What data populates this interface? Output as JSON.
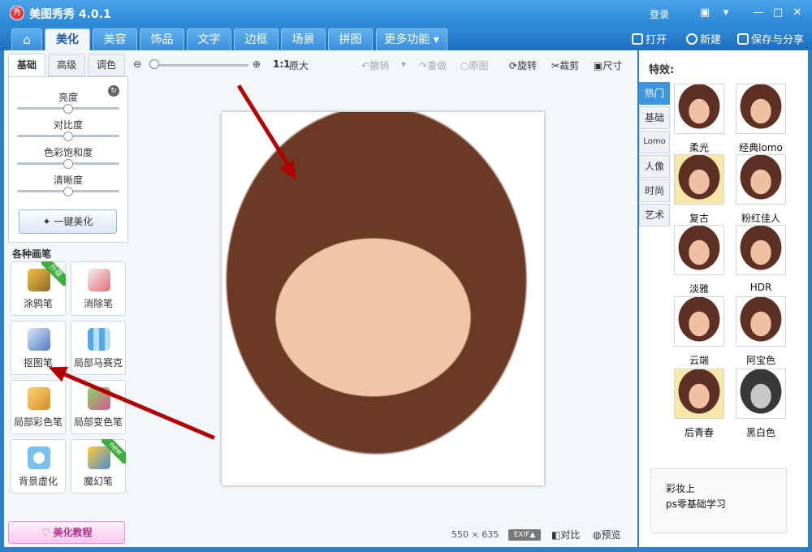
{
  "window": {
    "title": "美图秀秀 4.0.1",
    "logo_text": "秀",
    "login": "登录",
    "controls": [
      "▣",
      "▾",
      "—",
      "□",
      "✕"
    ]
  },
  "nav": {
    "home_icon": "home-icon",
    "tabs": [
      "美化",
      "美容",
      "饰品",
      "文字",
      "边框",
      "场景",
      "拼图",
      "更多功能 ▾"
    ],
    "actions": {
      "open": "打开",
      "new": "新建",
      "save_share": "保存与分享"
    }
  },
  "left": {
    "tabs": [
      "基础",
      "高级",
      "调色"
    ],
    "sliders": [
      {
        "label": "亮度",
        "value": 0.5
      },
      {
        "label": "对比度",
        "value": 0.5
      },
      {
        "label": "色彩饱和度",
        "value": 0.5
      },
      {
        "label": "清晰度",
        "value": 0.5
      }
    ],
    "one_click": "一键美化",
    "brushes_title": "各种画笔",
    "brushes": [
      {
        "label": "涂鸦笔",
        "badge": "升级",
        "icon": "pencil-icon"
      },
      {
        "label": "消除笔",
        "badge": "",
        "icon": "eraser-icon"
      },
      {
        "label": "抠图笔",
        "badge": "",
        "icon": "cutout-pen-icon"
      },
      {
        "label": "局部马赛克",
        "badge": "",
        "icon": "mosaic-icon"
      },
      {
        "label": "局部彩色笔",
        "badge": "",
        "icon": "color-brush-icon"
      },
      {
        "label": "局部变色笔",
        "badge": "",
        "icon": "recolor-bucket-icon"
      },
      {
        "label": "背景虚化",
        "badge": "",
        "icon": "blur-icon"
      },
      {
        "label": "魔幻笔",
        "badge": "new",
        "icon": "magic-pen-icon"
      }
    ],
    "tutorial": "美化教程"
  },
  "toolbar": {
    "zoom_ratio": "1:1",
    "original_size": "原大",
    "undo": "撤销",
    "redo": "重做",
    "original": "原图",
    "rotate": "旋转",
    "crop": "裁剪",
    "size": "尺寸"
  },
  "canvas": {
    "width": "550",
    "times": "×",
    "height": "635",
    "exif": "EXIF▲",
    "compare": "对比",
    "preview": "预览"
  },
  "effects": {
    "title": "特效:",
    "categories": [
      "热门",
      "基础",
      "Lomo",
      "人像",
      "时尚",
      "艺术"
    ],
    "items": [
      "柔光",
      "经典lomo",
      "复古",
      "粉红佳人",
      "淡雅",
      "HDR",
      "云端",
      "阿宝色",
      "后青春",
      "黑白色"
    ],
    "ad": [
      "彩妆上",
      "ps零基础学习"
    ]
  },
  "colors": {
    "brand": "#2b86d6",
    "active_category": "#3d96df",
    "arrow": "#b00000"
  }
}
